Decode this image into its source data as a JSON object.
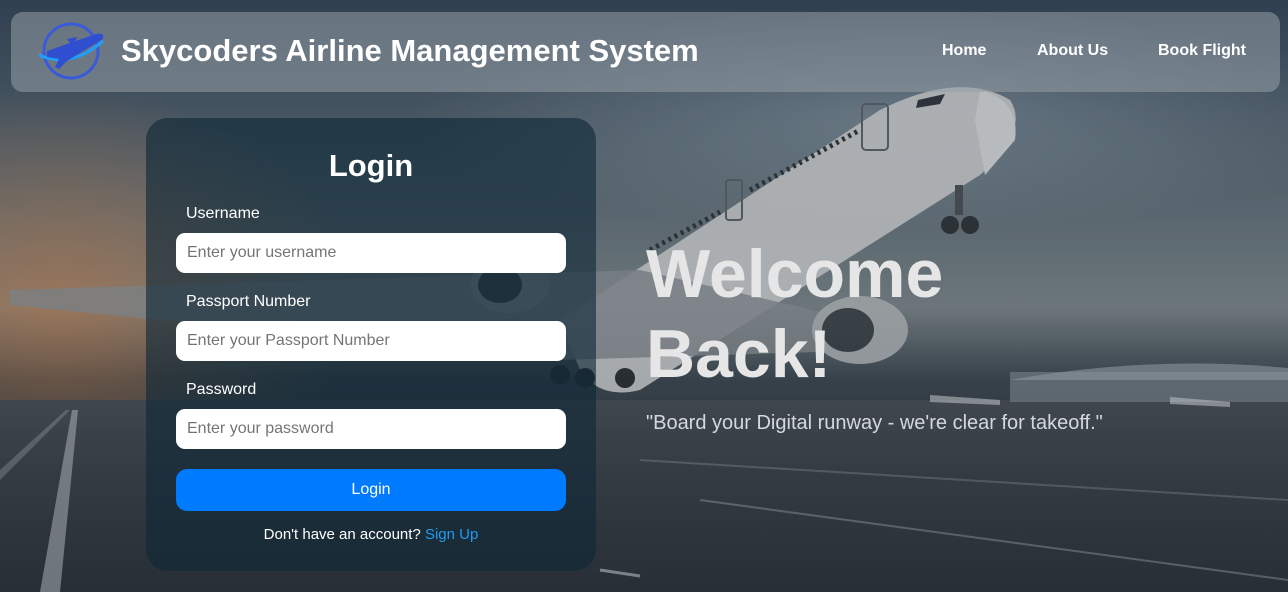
{
  "header": {
    "brand": "Skycoders Airline Management System",
    "nav": {
      "home": "Home",
      "about": "About Us",
      "book": "Book Flight"
    }
  },
  "login": {
    "title": "Login",
    "fields": {
      "username": {
        "label": "Username",
        "placeholder": "Enter your username",
        "value": ""
      },
      "passport": {
        "label": "Passport Number",
        "placeholder": "Enter your Passport Number",
        "value": ""
      },
      "password": {
        "label": "Password",
        "placeholder": "Enter your password",
        "value": ""
      }
    },
    "button": "Login",
    "signup_prompt": "Don't have an account?",
    "signup_link": "Sign Up"
  },
  "hero": {
    "title_line1": "Welcome",
    "title_line2": "Back!",
    "tagline": "\"Board your Digital runway - we're clear for takeoff.\""
  },
  "colors": {
    "primary_button": "#007bff",
    "link": "#1e9bf0",
    "logo": "#3a5bd9"
  },
  "icons": {
    "logo": "airplane-globe-icon"
  }
}
